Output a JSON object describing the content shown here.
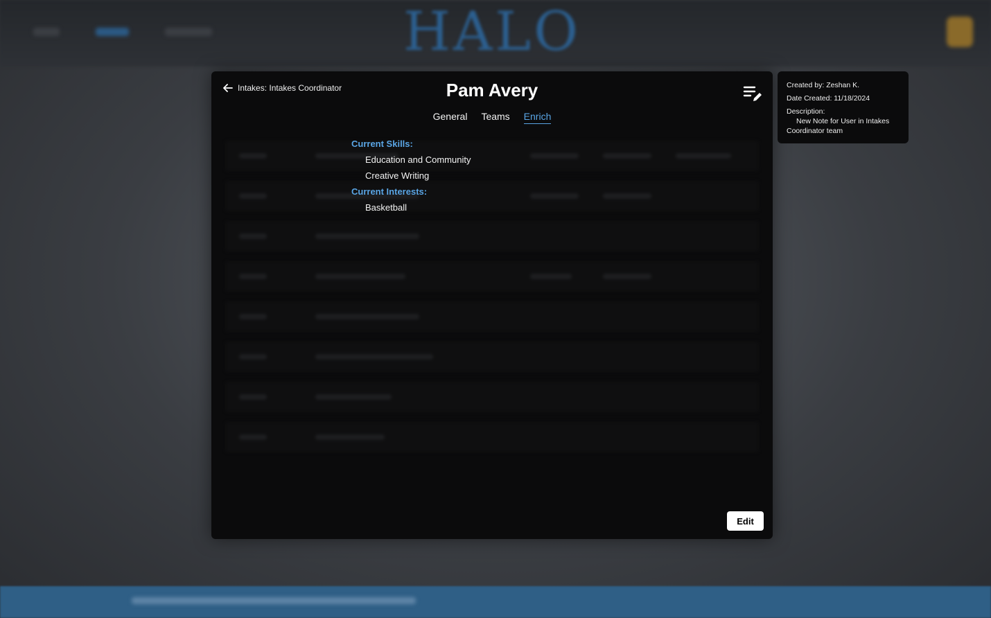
{
  "background": {
    "logo_text": "HALO",
    "accent_color": "#2c5f8f",
    "footer_color": "#2f5f86"
  },
  "modal": {
    "back_label": "Intakes: Intakes Coordinator",
    "title": "Pam Avery",
    "tabs": [
      {
        "label": "General",
        "active": false
      },
      {
        "label": "Teams",
        "active": false
      },
      {
        "label": "Enrich",
        "active": true
      }
    ],
    "skills_label": "Current Skills:",
    "skills": [
      "Education and Community",
      "Creative Writing"
    ],
    "interests_label": "Current Interests:",
    "interests": [
      "Basketball"
    ],
    "edit_label": "Edit",
    "edit_note_icon": "note-edit-icon",
    "link_color": "#5aa6e6"
  },
  "note": {
    "created_by": "Created by: Zeshan K.",
    "date_created": "Date Created: 11/18/2024",
    "description_label": "Description:",
    "description": "New Note for User in Intakes Coordinator team"
  }
}
